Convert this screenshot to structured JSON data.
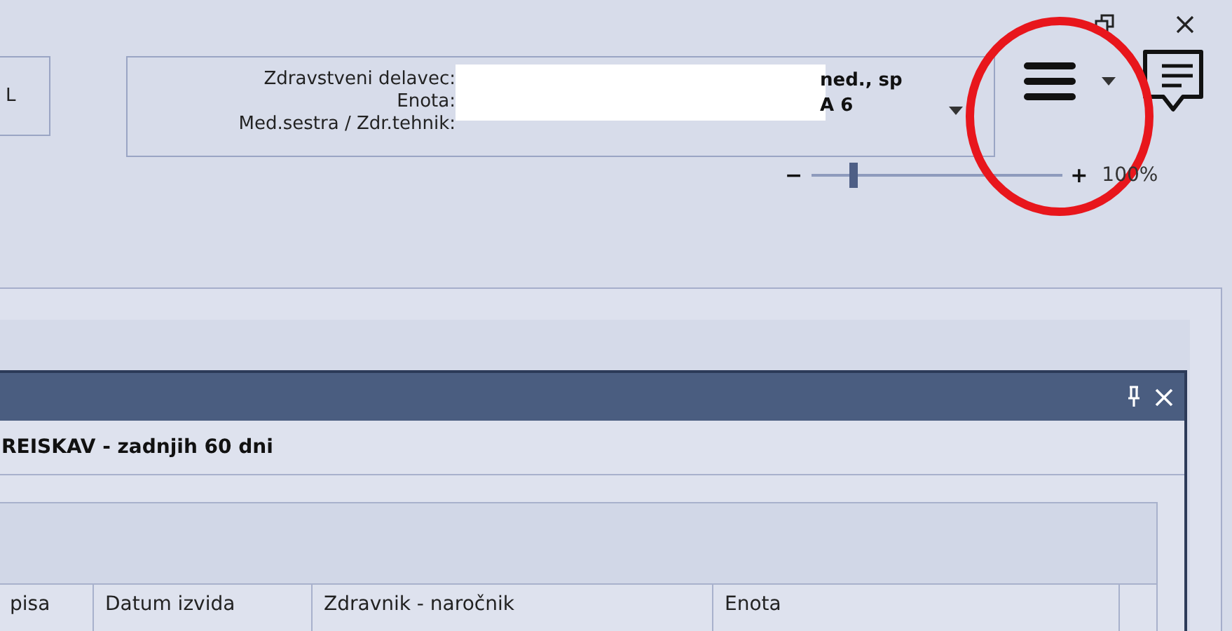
{
  "left_button": {
    "label": "L"
  },
  "staff_box": {
    "labels": [
      "Zdravstveni delavec:",
      "Enota:",
      "Med.sestra / Zdr.tehnik:"
    ],
    "values": [
      "ned., sp",
      "A 6"
    ]
  },
  "zoom": {
    "minus": "−",
    "plus": "+",
    "level": 0.17,
    "reading": "100%"
  },
  "panel": {
    "title": "REISKAV - zadnjih 60 dni",
    "columns": [
      "pisa",
      "Datum izvida",
      "Zdravnik - naročnik",
      "Enota"
    ]
  }
}
